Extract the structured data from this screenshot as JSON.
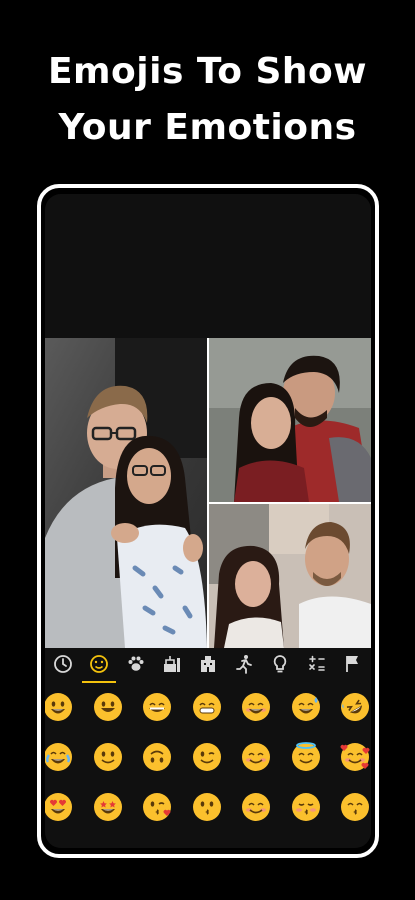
{
  "headline": {
    "line1": "Emojis To Show",
    "line2": "Your Emotions"
  },
  "colors": {
    "background": "#000000",
    "frame": "#ffffff",
    "accent": "#f4c20d",
    "emoji_yellow": "#fbc02d"
  },
  "photos": [
    {
      "name": "couple-hug-glasses"
    },
    {
      "name": "couple-forehead-kiss"
    },
    {
      "name": "couple-smiling-street"
    }
  ],
  "emoji_tabs": [
    {
      "icon": "recent-clock-icon",
      "selected": false
    },
    {
      "icon": "smiley-icon",
      "selected": true
    },
    {
      "icon": "paw-icon",
      "selected": false
    },
    {
      "icon": "food-icon",
      "selected": false
    },
    {
      "icon": "building-icon",
      "selected": false
    },
    {
      "icon": "running-person-icon",
      "selected": false
    },
    {
      "icon": "lightbulb-icon",
      "selected": false
    },
    {
      "icon": "symbols-icon",
      "selected": false
    },
    {
      "icon": "flag-icon",
      "selected": false
    }
  ],
  "emojis": [
    "grinning",
    "smiley",
    "grin-wide",
    "beaming",
    "laughing-smile",
    "sweat-smile",
    "rolling-laughing",
    "joy",
    "slight-smile",
    "upside-down",
    "wink",
    "smiling-blush",
    "halo",
    "smiling-hearts",
    "heart-eyes",
    "star-struck",
    "kiss-heart",
    "kissing",
    "relaxed",
    "kissing-closed-eyes",
    "kissing-smiling-eyes"
  ]
}
